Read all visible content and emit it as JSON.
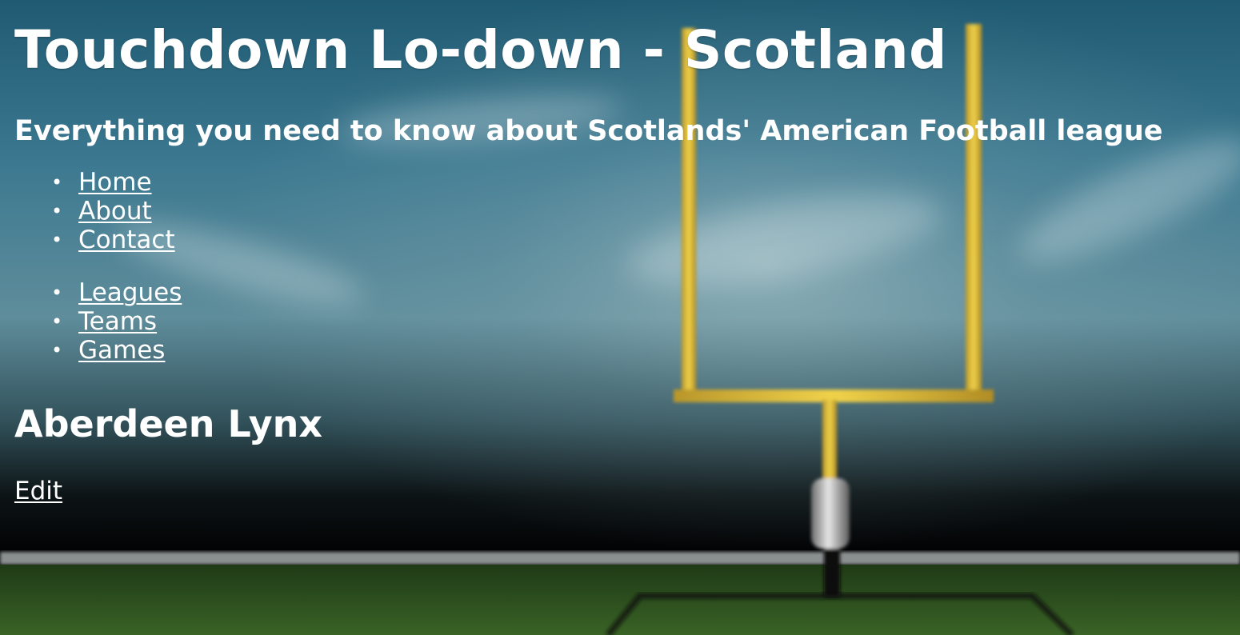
{
  "header": {
    "title": "Touchdown Lo-down - Scotland",
    "subtitle": "Everything you need to know about Scotlands' American Football league"
  },
  "nav_primary": [
    {
      "label": "Home"
    },
    {
      "label": "About"
    },
    {
      "label": "Contact"
    }
  ],
  "nav_secondary": [
    {
      "label": "Leagues"
    },
    {
      "label": "Teams"
    },
    {
      "label": "Games"
    }
  ],
  "main": {
    "team_name": "Aberdeen Lynx",
    "edit_label": "Edit"
  },
  "icons": {
    "bullet": "•",
    "background": "goal-post-stadium-image"
  }
}
